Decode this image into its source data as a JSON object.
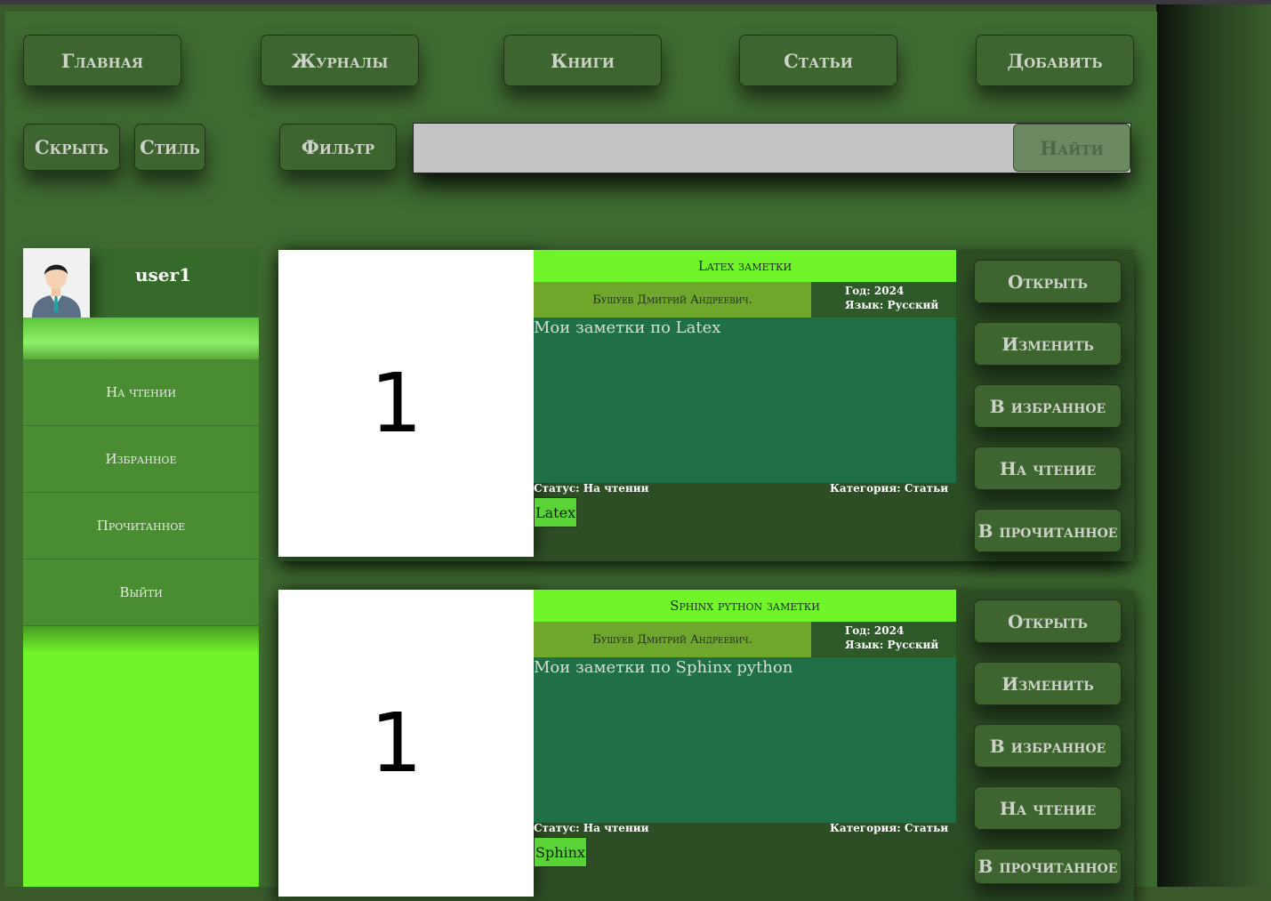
{
  "nav": {
    "home": "Главная",
    "journals": "Журналы",
    "books": "Книги",
    "articles": "Статьи",
    "add": "Добавить"
  },
  "toolbar": {
    "hide": "Скрыть",
    "style": "Стиль",
    "filter": "Фильтр",
    "search_value": "",
    "search_button": "Найти"
  },
  "sidebar": {
    "username": "user1",
    "items": [
      "На чтении",
      "Избранное",
      "Прочитанное",
      "Выйти"
    ]
  },
  "cards": [
    {
      "image_label": "1",
      "title": "Latex заметки",
      "author": "Бушуев Дмитрий Андреевич.",
      "year": "Год: 2024",
      "language": "Язык: Русский",
      "description": "Мои заметки по Latex",
      "status": "Статус: На чтении",
      "category": "Категория: Статьи",
      "tag": "Latex"
    },
    {
      "image_label": "1",
      "title": "Sphinx python заметки",
      "author": "Бушуев Дмитрий Андреевич.",
      "year": "Год: 2024",
      "language": "Язык: Русский",
      "description": "Мои заметки по Sphinx python",
      "status": "Статус: На чтении",
      "category": "Категория: Статьи",
      "tag": "Sphinx"
    }
  ],
  "card_actions": [
    "Открыть",
    "Изменить",
    "В избранное",
    "На чтение",
    "В прочитанное"
  ],
  "colors": {
    "accent_green": "#70f52a",
    "card_body": "#216f46",
    "frame": "#3f6b31"
  }
}
